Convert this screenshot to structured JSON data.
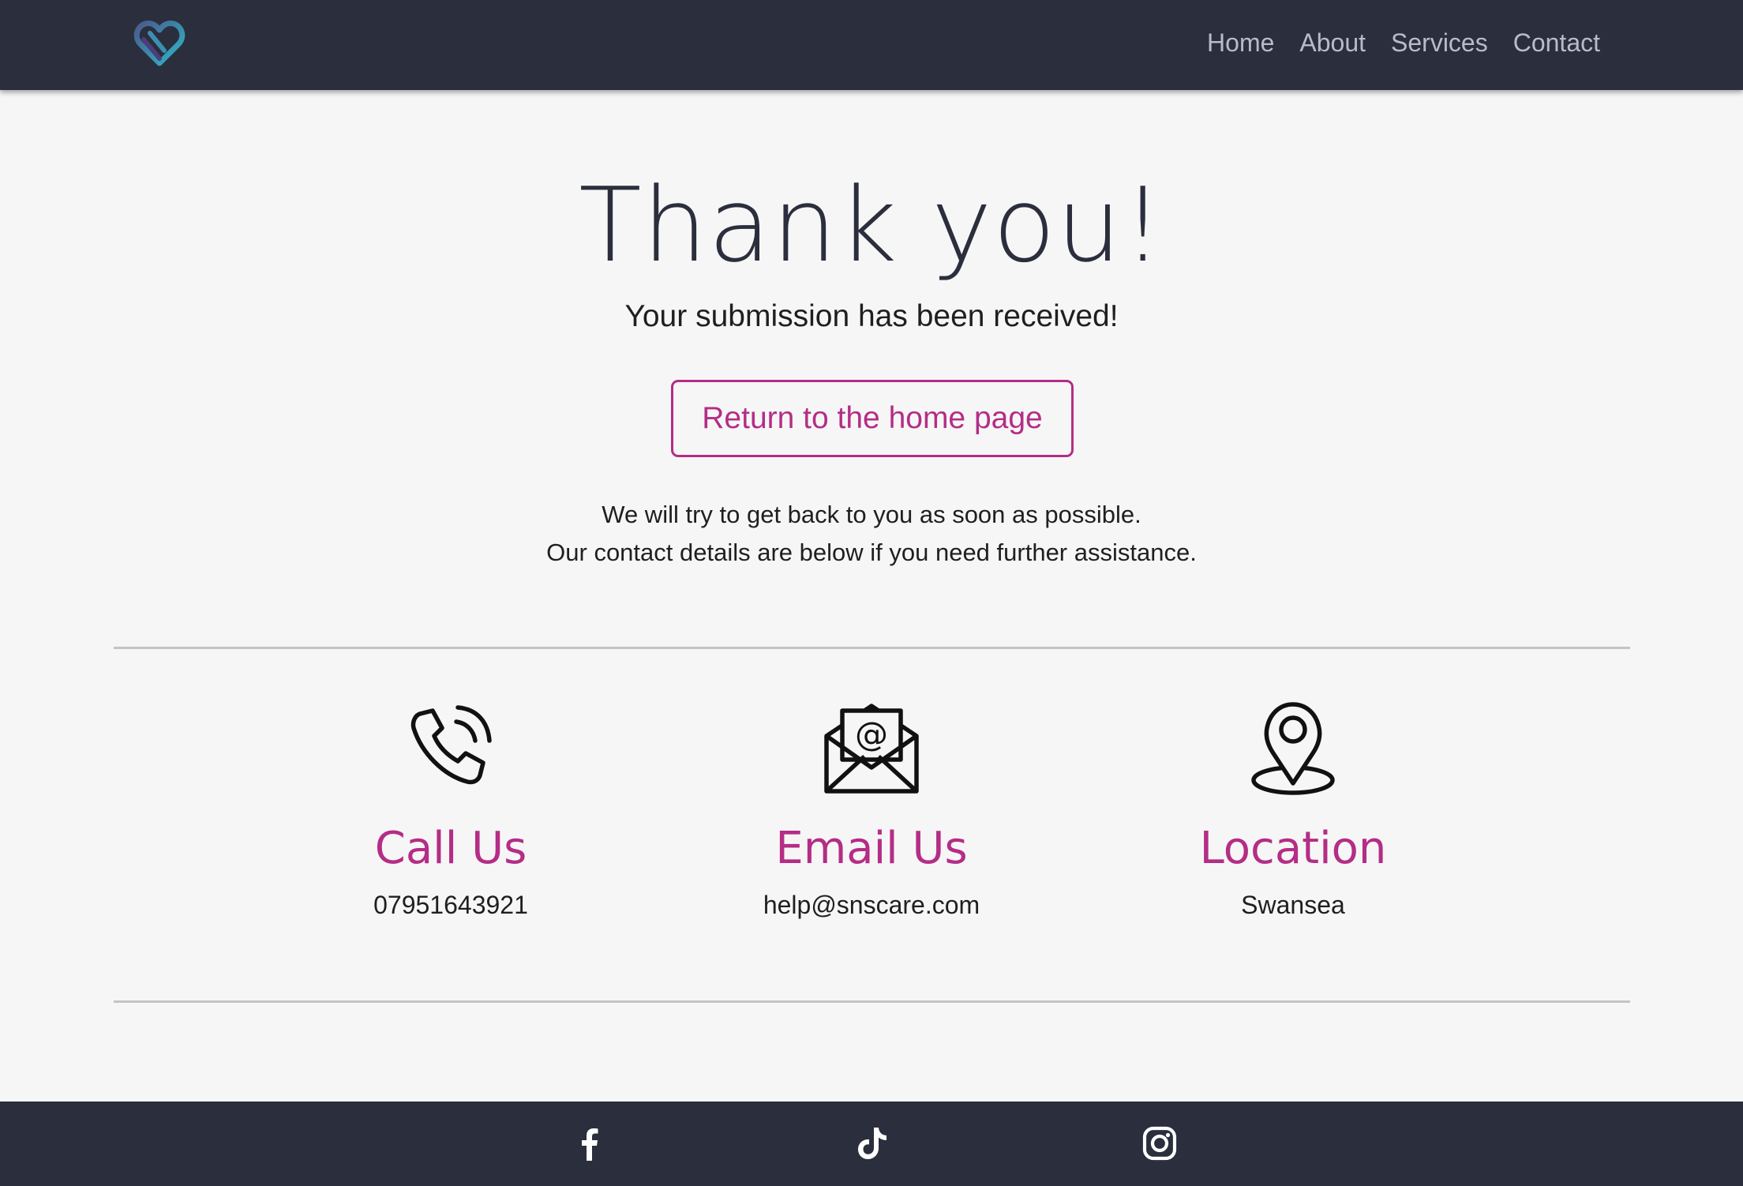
{
  "nav": {
    "links": [
      "Home",
      "About",
      "Services",
      "Contact"
    ]
  },
  "hero": {
    "title": "Thank you!",
    "subtitle": "Your submission has been received!",
    "button_label": "Return to the home page",
    "message_line1": "We will try to get back to you as soon as possible.",
    "message_line2": "Our contact details are below if you need further assistance."
  },
  "contacts": [
    {
      "icon": "phone-icon",
      "heading": "Call Us",
      "value": "07951643921"
    },
    {
      "icon": "envelope-icon",
      "heading": "Email Us",
      "value": "help@snscare.com"
    },
    {
      "icon": "location-pin-icon",
      "heading": "Location",
      "value": "Swansea"
    }
  ],
  "footer": {
    "social_icons": [
      "facebook-icon",
      "tiktok-icon",
      "instagram-icon"
    ]
  },
  "colors": {
    "navbar_bg": "#2b2e3c",
    "accent": "#b42d86",
    "page_bg": "#f6f6f6",
    "divider": "#c4c4c4"
  }
}
